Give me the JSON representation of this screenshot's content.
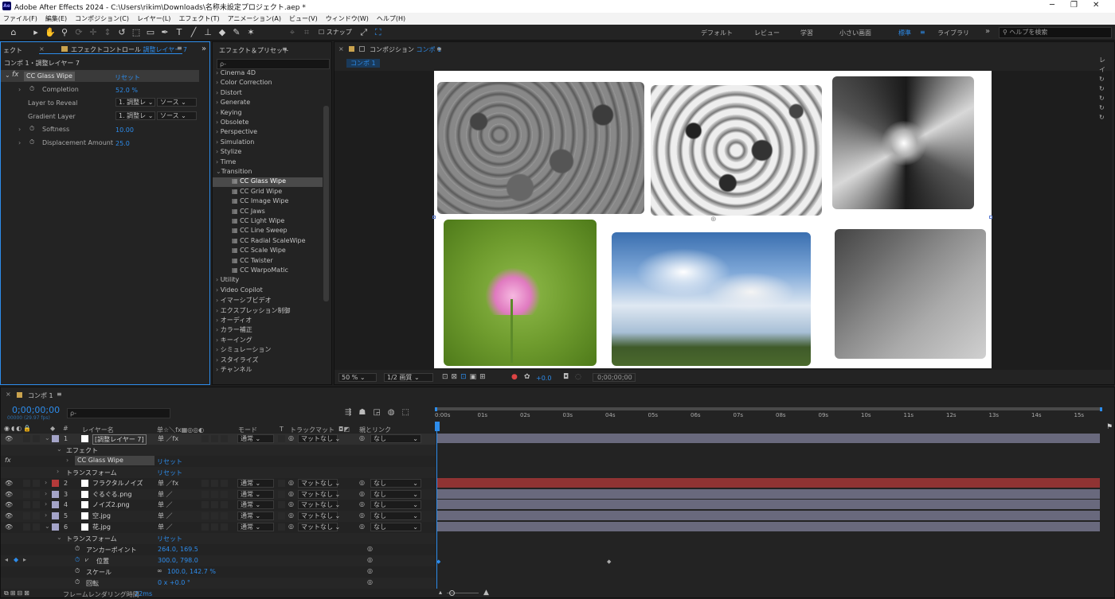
{
  "app": {
    "logo": "Ae",
    "title": "Adobe After Effects 2024 - C:\\Users\\rikim\\Downloads\\名称未設定プロジェクト.aep *"
  },
  "window_controls": {
    "minimize": "─",
    "maximize": "❐",
    "close": "✕"
  },
  "menu": [
    "ファイル(F)",
    "編集(E)",
    "コンポジション(C)",
    "レイヤー(L)",
    "エフェクト(T)",
    "アニメーション(A)",
    "ビュー(V)",
    "ウィンドウ(W)",
    "ヘルプ(H)"
  ],
  "toolbar": {
    "snap_label": "スナップ",
    "workspaces": [
      "デフォルト",
      "レビュー",
      "学習",
      "小さい画面",
      "標準",
      "ライブラリ"
    ],
    "active_workspace": "標準",
    "help_placeholder": "ヘルプを検索"
  },
  "effect_controls": {
    "left_tab": "ェクト",
    "tab_label": "エフェクトコントロール",
    "tab_layer": "調整レイヤー 7",
    "breadcrumb": "コンポ 1・調整レイヤー 7",
    "effect_name": "CC Glass Wipe",
    "reset": "リセット",
    "params": [
      {
        "name": "Completion",
        "value": "52.0 %"
      },
      {
        "name": "Layer to Reveal",
        "value": "1. 調整レ",
        "src": "ソース"
      },
      {
        "name": "Gradient Layer",
        "value": "1. 調整レ",
        "src": "ソース"
      },
      {
        "name": "Softness",
        "value": "10.00"
      },
      {
        "name": "Displacement Amount",
        "value": "25.0"
      }
    ]
  },
  "effects_presets": {
    "tab": "エフェクト＆プリセット",
    "search_placeholder": "ρ-",
    "categories_top": [
      "Cinema 4D",
      "Color Correction",
      "Distort",
      "Generate",
      "Keying",
      "Obsolete",
      "Perspective",
      "Simulation",
      "Stylize",
      "Time"
    ],
    "open_category": "Transition",
    "transition_items": [
      "CC Glass Wipe",
      "CC Grid Wipe",
      "CC Image Wipe",
      "CC Jaws",
      "CC Light Wipe",
      "CC Line Sweep",
      "CC Radial ScaleWipe",
      "CC Scale Wipe",
      "CC Twister",
      "CC WarpoMatic"
    ],
    "categories_bottom": [
      "Utility",
      "Video Copilot",
      "イマーシブビデオ",
      "エクスプレッション制御",
      "オーディオ",
      "カラー補正",
      "キーイング",
      "シミュレーション",
      "スタイライズ",
      "チャンネル"
    ]
  },
  "composition": {
    "tab_label": "コンポジション",
    "tab_comp": "コンポ 1",
    "comp_chip": "コンポ 1",
    "zoom": "50 %",
    "resolution": "1/2 画質",
    "exposure": "+0.0",
    "timecode": "0;00;00;00"
  },
  "timeline": {
    "tab": "コンポ 1",
    "timecode": "0;00;00;00",
    "fps": "00000 (29.97 fps)",
    "search_placeholder": "ρ-",
    "headers": {
      "layer_name": "レイヤー名",
      "switches": "单☆＼fx▦◎◎◐",
      "mode": "モード",
      "t": "T",
      "track_matte": "トラックマット",
      "parent": "親とリンク"
    },
    "ruler": [
      "0:00s",
      "01s",
      "02s",
      "03s",
      "04s",
      "05s",
      "06s",
      "07s",
      "08s",
      "09s",
      "10s",
      "11s",
      "12s",
      "13s",
      "14s",
      "15s"
    ],
    "layers": [
      {
        "num": "1",
        "name": "[調整レイヤー 7]",
        "mode": "通常",
        "matte": "マットなし",
        "parent": "なし",
        "color": "#a4a4c8"
      },
      {
        "num": "2",
        "name": "フラクタルノイズ",
        "mode": "通常",
        "matte": "マットなし",
        "parent": "なし",
        "color": "#b53a3a"
      },
      {
        "num": "3",
        "name": "ぐるぐる.png",
        "mode": "通常",
        "matte": "マットなし",
        "parent": "なし",
        "color": "#a4a4c8"
      },
      {
        "num": "4",
        "name": "ノイズ2.png",
        "mode": "通常",
        "matte": "マットなし",
        "parent": "なし",
        "color": "#a4a4c8"
      },
      {
        "num": "5",
        "name": "空.jpg",
        "mode": "通常",
        "matte": "マットなし",
        "parent": "なし",
        "color": "#a4a4c8"
      },
      {
        "num": "6",
        "name": "花.jpg",
        "mode": "通常",
        "matte": "マットなし",
        "parent": "なし",
        "color": "#a4a4c8"
      }
    ],
    "effect_group": "エフェクト",
    "effect_item": "CC Glass Wipe",
    "transform": "トランスフォーム",
    "reset": "リセット",
    "transform_props": [
      {
        "name": "アンカーポイント",
        "value": "264.0, 169.5"
      },
      {
        "name": "位置",
        "value": "300.0, 798.0"
      },
      {
        "name": "スケール",
        "value": "100.0, 142.7 %"
      },
      {
        "name": "回転",
        "value": "0 x +0.0 °"
      }
    ],
    "render_time_label": "フレームレンダリング時間",
    "render_time": "22ms"
  }
}
